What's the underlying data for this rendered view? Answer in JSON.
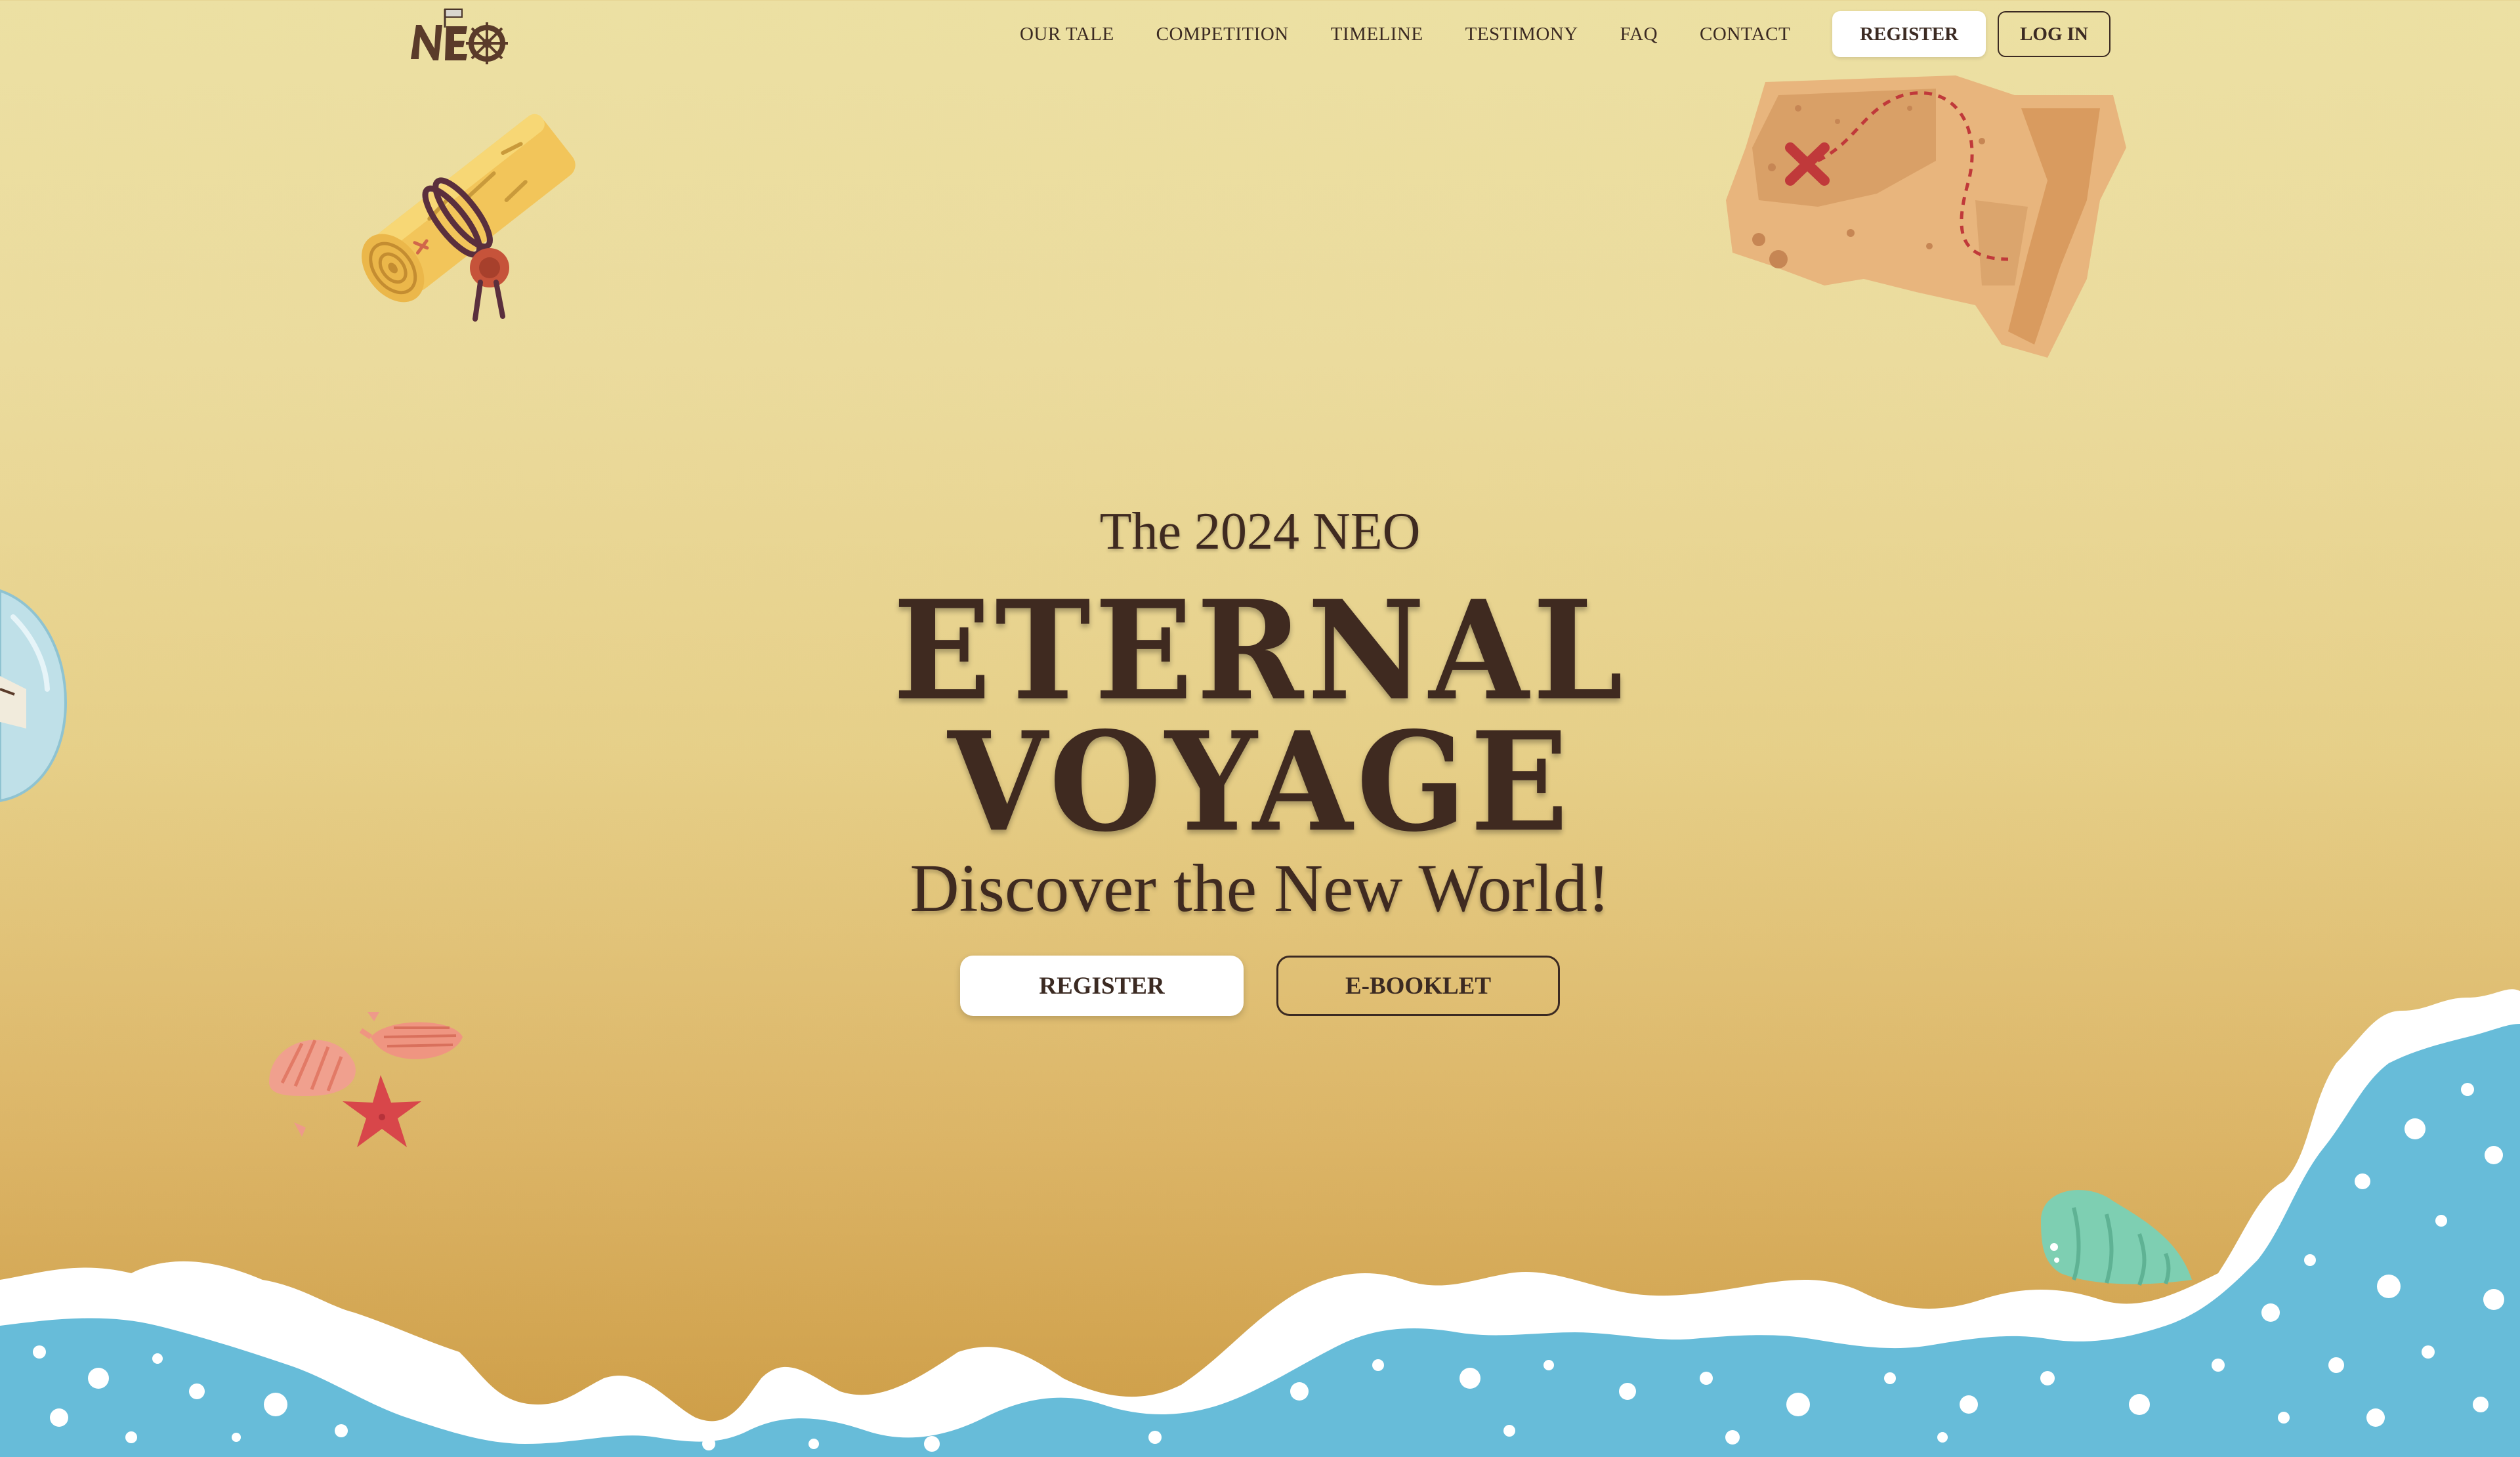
{
  "brand": {
    "logo_text": "NEO"
  },
  "nav": {
    "items": [
      "OUR TALE",
      "COMPETITION",
      "TIMELINE",
      "TESTIMONY",
      "FAQ",
      "CONTACT"
    ],
    "register_label": "REGISTER",
    "login_label": "LOG IN"
  },
  "hero": {
    "year_line": "The 2024 NEO",
    "title_line1": "ETERNAL",
    "title_line2": "VOYAGE",
    "subtitle": "Discover the New World!",
    "register_label": "REGISTER",
    "ebooklet_label": "E-BOOKLET"
  },
  "colors": {
    "sand_top": "#ece0a3",
    "sand_bottom": "#cd9c45",
    "text_brown": "#3f2a20",
    "sea_blue": "#67bcd9",
    "foam_white": "#ffffff"
  },
  "icons": {
    "scroll": "rolled-map-scroll-icon",
    "map": "treasure-map-icon",
    "bottle": "message-bottle-icon",
    "shells": "seashells-starfish-icon",
    "conch": "conch-shell-icon",
    "waves": "ocean-waves"
  }
}
